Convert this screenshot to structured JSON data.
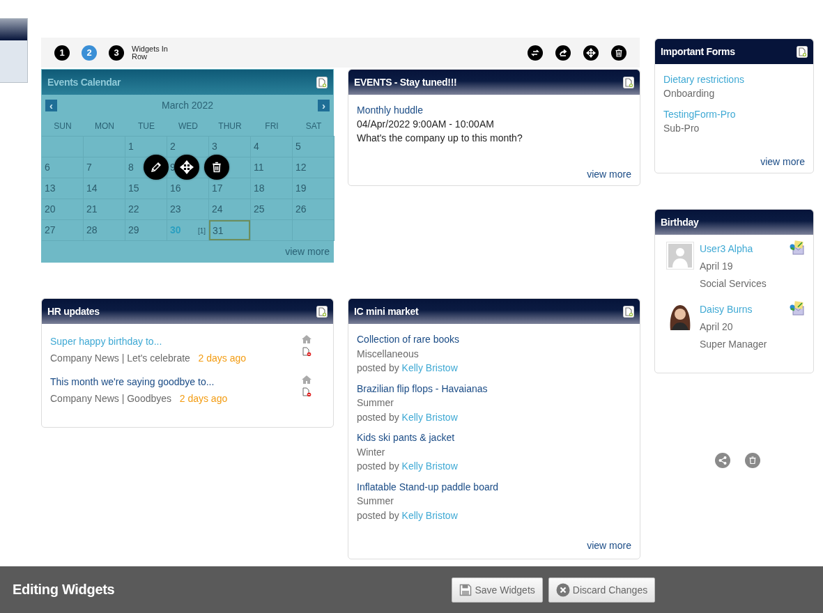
{
  "toolbar": {
    "row_options": [
      {
        "label": "1",
        "selected": false
      },
      {
        "label": "2",
        "selected": true
      },
      {
        "label": "3",
        "selected": false
      }
    ],
    "row_label": "Widgets In Row"
  },
  "main_widgets": [
    {
      "kind": "calendar",
      "title": "Events Calendar",
      "selected": true,
      "month": "March 2022",
      "prev": "‹",
      "next": "›",
      "weekdays": [
        "SUN",
        "MON",
        "TUE",
        "WED",
        "THUR",
        "FRI",
        "SAT"
      ],
      "weeks": [
        [
          {
            "kind": "blank"
          },
          {
            "kind": "blank"
          },
          {
            "kind": "day",
            "day": "1"
          },
          {
            "kind": "day",
            "day": "2"
          },
          {
            "kind": "day",
            "day": "3"
          },
          {
            "kind": "day",
            "day": "4"
          },
          {
            "kind": "day",
            "day": "5"
          }
        ],
        [
          {
            "kind": "day",
            "day": "6"
          },
          {
            "kind": "day",
            "day": "7"
          },
          {
            "kind": "day",
            "day": "8"
          },
          {
            "kind": "day",
            "day": "9"
          },
          {
            "kind": "blank"
          },
          {
            "kind": "day",
            "day": "11"
          },
          {
            "kind": "day",
            "day": "12"
          }
        ],
        [
          {
            "kind": "day",
            "day": "13"
          },
          {
            "kind": "day",
            "day": "14"
          },
          {
            "kind": "day",
            "day": "15"
          },
          {
            "kind": "day",
            "day": "16"
          },
          {
            "kind": "day",
            "day": "17"
          },
          {
            "kind": "day",
            "day": "18"
          },
          {
            "kind": "day",
            "day": "19"
          }
        ],
        [
          {
            "kind": "day",
            "day": "20"
          },
          {
            "kind": "day",
            "day": "21"
          },
          {
            "kind": "day",
            "day": "22"
          },
          {
            "kind": "day",
            "day": "23"
          },
          {
            "kind": "day",
            "day": "24"
          },
          {
            "kind": "day",
            "day": "25"
          },
          {
            "kind": "day",
            "day": "26"
          }
        ],
        [
          {
            "kind": "day",
            "day": "27"
          },
          {
            "kind": "day",
            "day": "28"
          },
          {
            "kind": "day",
            "day": "29"
          },
          {
            "kind": "day",
            "day": "30",
            "has_event": true,
            "count": "[1]"
          },
          {
            "kind": "day",
            "day": "31",
            "today": true
          },
          {
            "kind": "blank"
          },
          {
            "kind": "blank"
          }
        ]
      ],
      "view_more": "view more"
    },
    {
      "kind": "events",
      "title": "EVENTS - Stay tuned!!!",
      "selected": false,
      "items": [
        {
          "name": "Monthly huddle",
          "when": "04/Apr/2022 9:00AM - 10:00AM",
          "description": "What's the company up to this month?"
        }
      ],
      "view_more": "view more"
    },
    {
      "kind": "news",
      "title": "HR updates",
      "selected": false,
      "items": [
        {
          "title": "Super happy birthday to...",
          "visited": false,
          "meta": "Company News | Let's celebrate",
          "time": "2 days ago"
        },
        {
          "title": "This month we're saying goodbye to...",
          "visited": true,
          "meta": "Company News | Goodbyes",
          "time": "2 days ago"
        }
      ]
    },
    {
      "kind": "market",
      "title": "IC mini market",
      "selected": false,
      "items": [
        {
          "title": "Collection of rare books",
          "category": "Miscellaneous",
          "posted_by": "posted by",
          "author": "Kelly Bristow"
        },
        {
          "title": "Brazilian flip flops - Havaianas",
          "category": "Summer",
          "posted_by": "posted by",
          "author": "Kelly Bristow"
        },
        {
          "title": "Kids ski pants & jacket",
          "category": "Winter",
          "posted_by": "posted by",
          "author": "Kelly Bristow"
        },
        {
          "title": "Inflatable Stand-up paddle board",
          "category": "Summer",
          "posted_by": "posted by",
          "author": "Kelly Bristow"
        }
      ],
      "view_more": "view more"
    }
  ],
  "side_widgets": [
    {
      "kind": "forms",
      "title": "Important Forms",
      "items": [
        {
          "name": "Dietary restrictions",
          "category": "Onboarding"
        },
        {
          "name": "TestingForm-Pro",
          "category": "Sub-Pro"
        }
      ],
      "view_more": "view more"
    },
    {
      "kind": "birthday",
      "title": "Birthday",
      "people": [
        {
          "name": "User3 Alpha",
          "date": "April 19",
          "department": "Social Services",
          "photo": false
        },
        {
          "name": "Daisy Burns",
          "date": "April 20",
          "department": "Super Manager",
          "photo": true
        }
      ]
    }
  ],
  "footer": {
    "title": "Editing Widgets",
    "buttons": [
      {
        "kind": "save",
        "label": "Save Widgets"
      },
      {
        "kind": "discard",
        "label": "Discard Changes"
      }
    ]
  }
}
